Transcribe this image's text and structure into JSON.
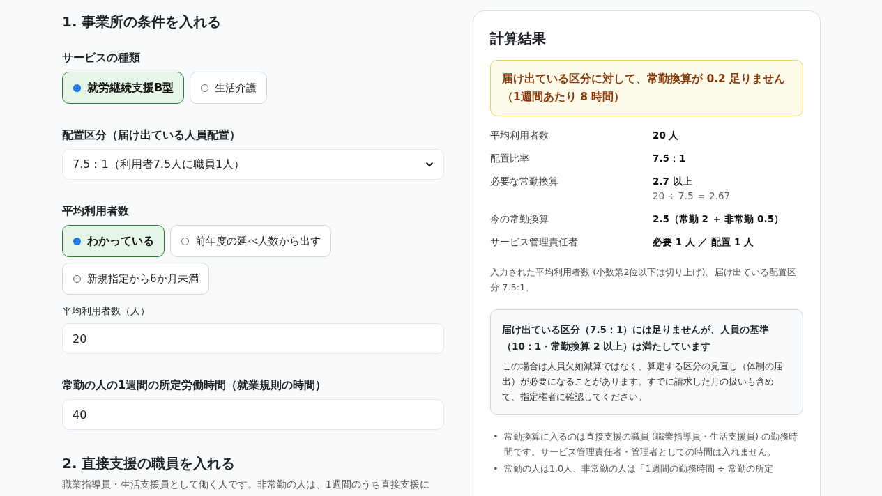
{
  "form": {
    "sections": [
      {
        "heading": "1. 事業所の条件を入れる",
        "fields": [
          {
            "kind": "radio",
            "label": "サービスの種類",
            "options": [
              {
                "label": "就労継続支援B型",
                "selected": true
              },
              {
                "label": "生活介護",
                "selected": false
              }
            ]
          },
          {
            "kind": "select",
            "label": "配置区分（届け出ている人員配置）",
            "value": "7.5：1（利用者7.5人に職員1人）"
          },
          {
            "kind": "radio",
            "label": "平均利用者数",
            "options": [
              {
                "label": "わかっている",
                "selected": true
              },
              {
                "label": "前年度の延べ人数から出す",
                "selected": false
              },
              {
                "label": "新規指定から6か月未満",
                "selected": false
              }
            ]
          },
          {
            "kind": "input",
            "label": "平均利用者数（人）",
            "value": "20",
            "small": true
          },
          {
            "kind": "input",
            "label": "常勤の人の1週間の所定労働時間（就業規則の時間）",
            "value": "40",
            "small": false
          }
        ]
      },
      {
        "heading": "2. 直接支援の職員を入れる",
        "description": "職業指導員・生活支援員として働く人です。非常勤の人は、1週間のうち直接支援に"
      }
    ]
  },
  "result": {
    "title": "計算結果",
    "alert": "届け出ている区分に対して、常勤換算が 0.2 足りません（1週間あたり 8 時間）",
    "rows": [
      {
        "label": "平均利用者数",
        "value": "20 人"
      },
      {
        "label": "配置比率",
        "value": "7.5：1"
      },
      {
        "label": "必要な常勤換算",
        "value": "2.7 以上",
        "detail": "20 ÷ 7.5 ＝ 2.67"
      },
      {
        "label": "今の常勤換算",
        "value": "2.5（常勤 2 ＋ 非常勤 0.5）"
      },
      {
        "label": "サービス管理責任者",
        "value": "必要 1 人 ／ 配置 1 人"
      }
    ],
    "note": "入力された平均利用者数 (小数第2位以下は切り上げ)。届け出ている配置区分 7.5:1。",
    "info": {
      "title": "届け出ている区分（7.5：1）には足りませんが、人員の基準（10：1・常勤換算 2 以上）は満たしています",
      "body": "この場合は人員欠如減算ではなく、算定する区分の見直し（体制の届出）が必要になることがあります。すでに請求した月の扱いも含めて、指定権者に確認してください。"
    },
    "bullets": [
      {
        "marker": "•",
        "text": "常勤換算に入るのは直接支援の職員 (職業指導員・生活支援員) の勤務時間です。サービス管理責任者・管理者としての時間は入れません。"
      },
      {
        "marker": "•",
        "text": "常勤の人は1.0人、非常勤の人は「1週間の勤務時間 ÷ 常勤の所定"
      }
    ]
  }
}
